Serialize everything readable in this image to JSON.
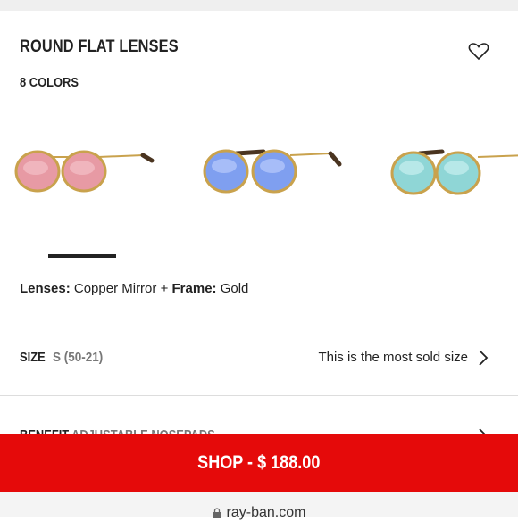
{
  "product": {
    "title": "ROUND FLAT LENSES",
    "colors_count": "8 COLORS"
  },
  "variants": [
    {
      "lens": "Copper Mirror",
      "lens_color": "#e79aa4",
      "frame_color": "#c9a24d"
    },
    {
      "lens": "Blue Mirror",
      "lens_color": "#7f9ff0",
      "frame_color": "#c9a24d"
    },
    {
      "lens": "Green Mirror",
      "lens_color": "#8fd6d6",
      "frame_color": "#c9a24d"
    }
  ],
  "spec": {
    "lenses_label": "Lenses:",
    "lenses_value": "Copper Mirror",
    "plus": "+",
    "frame_label": "Frame:",
    "frame_value": "Gold"
  },
  "size": {
    "label": "SIZE",
    "value": "S (50-21)",
    "note": "This is the most sold size"
  },
  "benefit": {
    "label": "BENEFIT",
    "value": "ADJUSTABLE NOSEPADS"
  },
  "shop_button": "SHOP - $ 188.00",
  "url": "ray-ban.com",
  "colors": {
    "accent": "#e50a0a",
    "text": "#222222",
    "muted": "#777777"
  }
}
